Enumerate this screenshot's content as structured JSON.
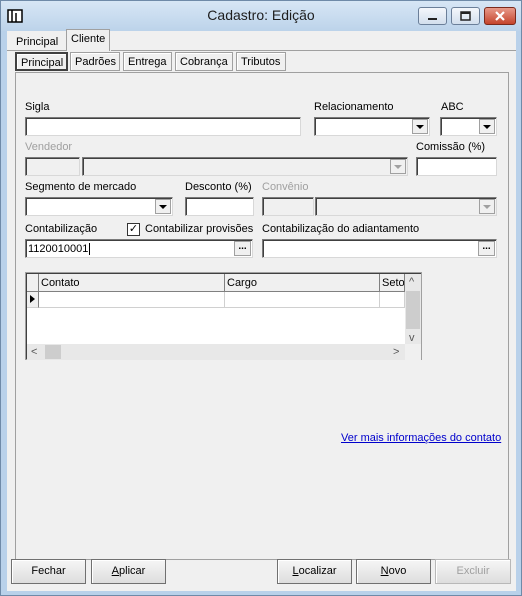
{
  "window": {
    "title": "Cadastro: Edição"
  },
  "tabs": [
    "Principal",
    "Cliente"
  ],
  "subtabs": [
    "Principal",
    "Padrões",
    "Entrega",
    "Cobrança",
    "Tributos"
  ],
  "form": {
    "sigla_label": "Sigla",
    "sigla_value": "",
    "relacionamento_label": "Relacionamento",
    "abc_label": "ABC",
    "vendedor_label": "Vendedor",
    "comissao_label": "Comissão (%)",
    "segmento_label": "Segmento de mercado",
    "desconto_label": "Desconto (%)",
    "convenio_label": "Convênio",
    "contabilizacao_label": "Contabilização",
    "contabilizacao_value": "1120010001",
    "contabilizar_provisoes_label": "Contabilizar provisões",
    "contabilizar_provisoes_checked": true,
    "contab_adiantamento_label": "Contabilização do adiantamento",
    "ellipsis": "..."
  },
  "grid": {
    "columns": [
      "Contato",
      "Cargo",
      "Seto"
    ]
  },
  "link": {
    "ver_mais": "Ver mais informações do contato"
  },
  "buttons": {
    "fechar": "Fechar",
    "aplicar": "Aplicar",
    "localizar": "Localizar",
    "novo": "Novo",
    "excluir": "Excluir"
  },
  "icons": {
    "app": "app-icon",
    "minimize": "minimize-icon",
    "maximize": "maximize-icon",
    "close": "close-icon",
    "row_pointer": "row-pointer-icon",
    "check": "checkmark-icon",
    "dropdown": "chevron-down-icon"
  },
  "colors": {
    "link": "#0000cc",
    "titlebar": "#bcd3ea",
    "close_button": "#c5442b"
  }
}
